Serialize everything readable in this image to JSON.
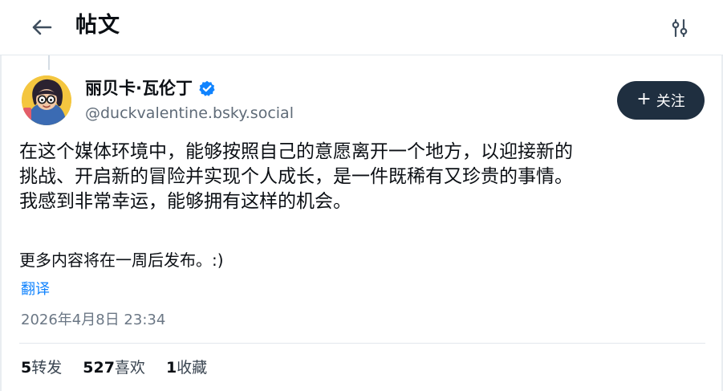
{
  "header": {
    "title": "帖文",
    "back_icon": "arrow-left-icon",
    "settings_icon": "sliders-icon"
  },
  "post": {
    "author": {
      "name": "丽贝卡·瓦伦丁",
      "handle": "@duckvalentine.bsky.social",
      "verified": true,
      "verified_color": "#1083fe"
    },
    "follow_label": "关注",
    "text_lines": [
      "在这个媒体环境中，能够按照自己的意愿离开一个地方，以迎接新的",
      "挑战、开启新的冒险并实现个人成长，是一件既稀有又珍贵的事情。",
      "我感到非常幸运，能够拥有这样的机会。"
    ],
    "text_extra": "更多内容将在一周后发布。:)",
    "translate_label": "翻译",
    "timestamp": "2026年4月8日 23:34",
    "stats": {
      "reposts_count": "5",
      "reposts_label": "转发",
      "likes_count": "527",
      "likes_label": "喜欢",
      "saves_count": "1",
      "saves_label": "收藏"
    }
  },
  "colors": {
    "accent": "#1083fe",
    "follow_bg": "#1f2f40",
    "muted": "#6b7785"
  }
}
